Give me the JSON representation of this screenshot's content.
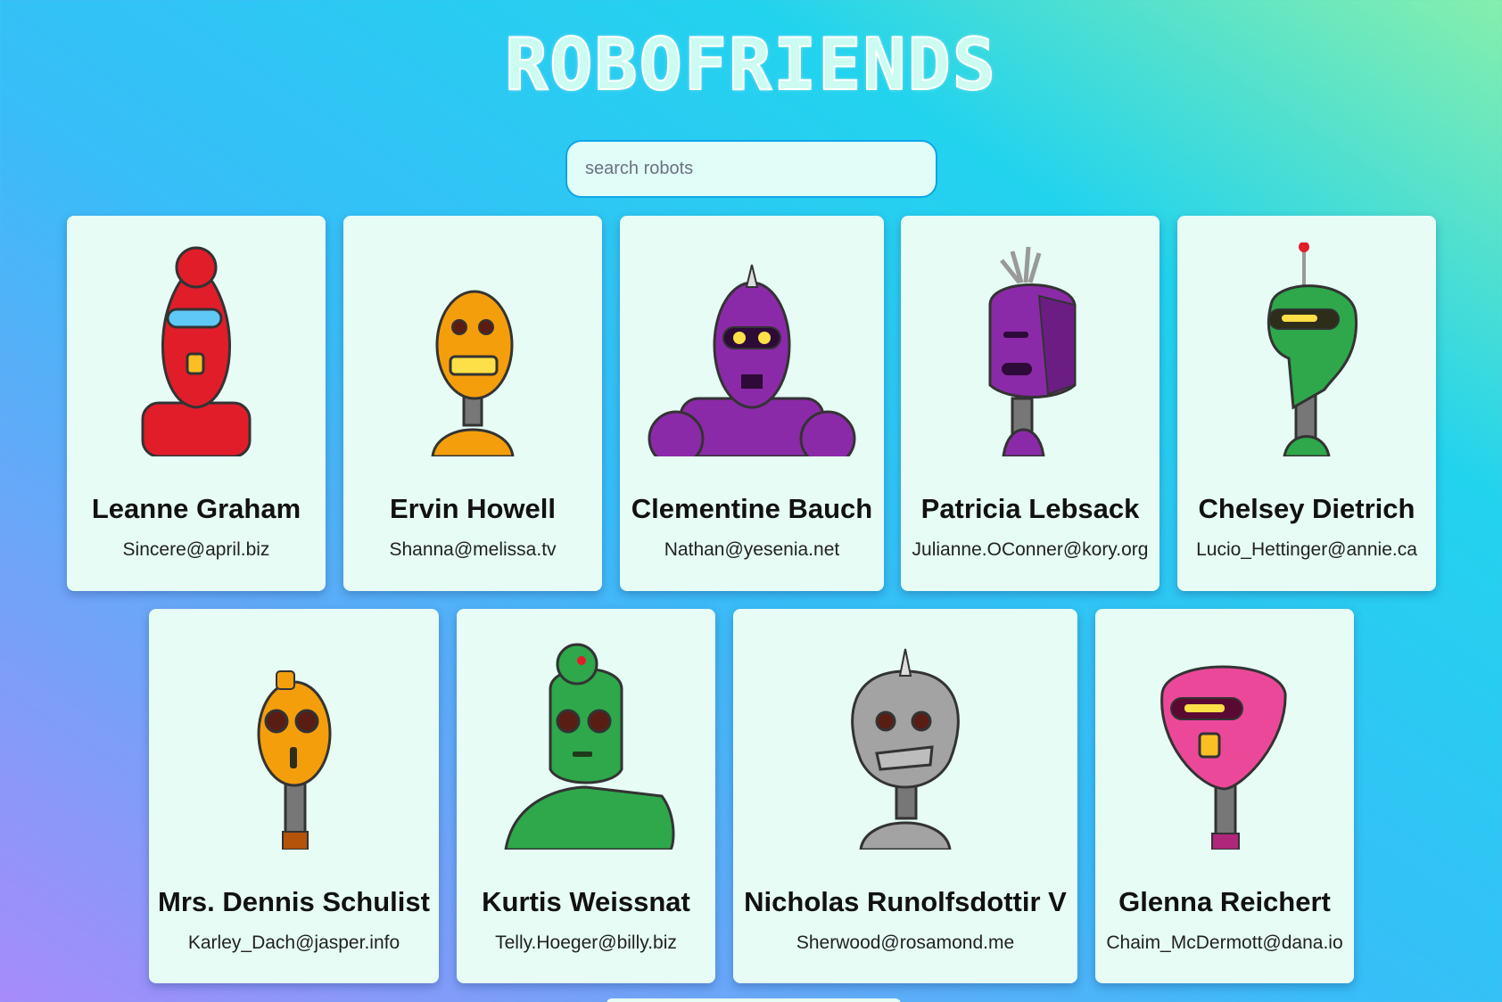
{
  "app": {
    "title": "ROBOFRIENDS"
  },
  "search": {
    "placeholder": "search robots"
  },
  "robots": [
    {
      "name": "Leanne Graham",
      "email": "Sincere@april.biz",
      "color": "#e11d2a"
    },
    {
      "name": "Ervin Howell",
      "email": "Shanna@melissa.tv",
      "color": "#f59e0b"
    },
    {
      "name": "Clementine Bauch",
      "email": "Nathan@yesenia.net",
      "color": "#8b2aa8"
    },
    {
      "name": "Patricia Lebsack",
      "email": "Julianne.OConner@kory.org",
      "color": "#8b2aa8"
    },
    {
      "name": "Chelsey Dietrich",
      "email": "Lucio_Hettinger@annie.ca",
      "color": "#2ea84a"
    },
    {
      "name": "Mrs. Dennis Schulist",
      "email": "Karley_Dach@jasper.info",
      "color": "#f59e0b"
    },
    {
      "name": "Kurtis Weissnat",
      "email": "Telly.Hoeger@billy.biz",
      "color": "#2ea84a"
    },
    {
      "name": "Nicholas Runolfsdottir V",
      "email": "Sherwood@rosamond.me",
      "color": "#a3a3a3"
    },
    {
      "name": "Glenna Reichert",
      "email": "Chaim_McDermott@dana.io",
      "color": "#ec4899"
    }
  ]
}
